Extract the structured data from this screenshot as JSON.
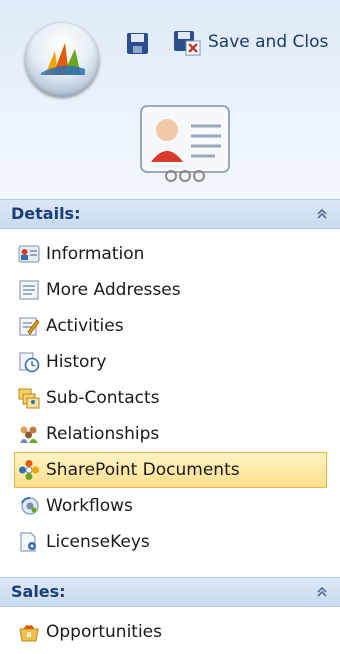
{
  "toolbar": {
    "save_and_close_label": "Save and Clos"
  },
  "sections": {
    "details": {
      "title": "Details:",
      "items": [
        {
          "label": "Information",
          "icon": "information-icon"
        },
        {
          "label": "More Addresses",
          "icon": "address-icon"
        },
        {
          "label": "Activities",
          "icon": "activities-icon"
        },
        {
          "label": "History",
          "icon": "history-icon"
        },
        {
          "label": "Sub-Contacts",
          "icon": "sub-contacts-icon"
        },
        {
          "label": "Relationships",
          "icon": "relationships-icon"
        },
        {
          "label": "SharePoint Documents",
          "icon": "sharepoint-icon",
          "selected": true
        },
        {
          "label": "Workflows",
          "icon": "workflows-icon"
        },
        {
          "label": "LicenseKeys",
          "icon": "license-keys-icon"
        }
      ]
    },
    "sales": {
      "title": "Sales:",
      "items": [
        {
          "label": "Opportunities",
          "icon": "opportunities-icon"
        }
      ]
    }
  },
  "colors": {
    "header_text": "#1c3f78",
    "selected_bg": "#ffe08e",
    "selected_border": "#e8b54a"
  }
}
